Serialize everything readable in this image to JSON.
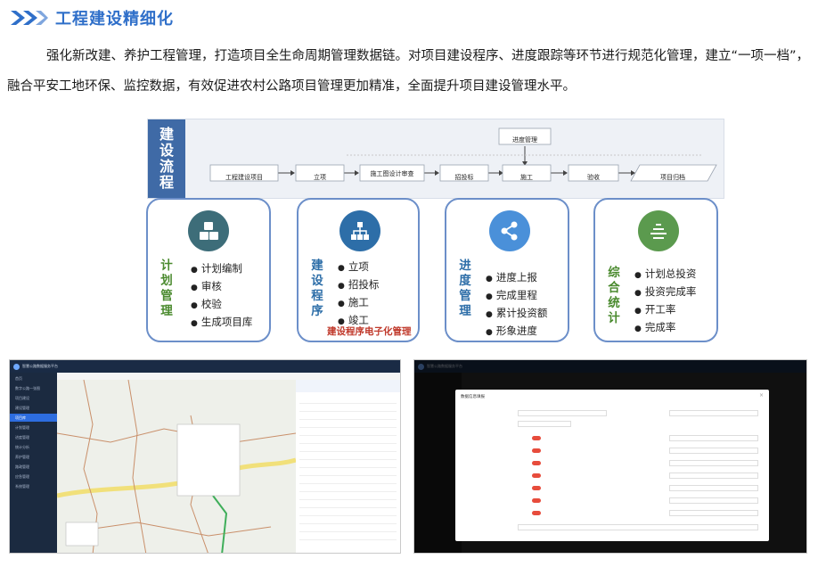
{
  "section": {
    "title": "工程建设精细化",
    "chevron_color": "#2f6fc9"
  },
  "paragraph": {
    "line1": "强化新改建、养护工程管理，打造项目全生命周期管理数据链。对项目建设程序、进度跟踪等环节进行规范化管理，建立“一项一档”，",
    "line2": "融合平安工地环保、监控数据，有效促进农村公路项目管理更加精准，全面提升项目建设管理水平。"
  },
  "flow": {
    "side_label": [
      "建",
      "设",
      "流",
      "程"
    ],
    "steps": [
      "工程建设项目",
      "立项",
      "施工图设计审查",
      "招投标",
      "施工",
      "验收",
      "项目归档"
    ],
    "top_step": "进度管理"
  },
  "cards": [
    {
      "title": [
        "计",
        "划",
        "管",
        "理"
      ],
      "items": [
        "计划编制",
        "审核",
        "校验",
        "生成项目库"
      ],
      "icon": "cubes-icon",
      "color": "#3d6d79"
    },
    {
      "title": [
        "建",
        "设",
        "程",
        "序"
      ],
      "items": [
        "立项",
        "招投标",
        "施工",
        "竣工"
      ],
      "note": "建设程序电子化管理",
      "icon": "org-chart-icon",
      "color": "#2d6ea8"
    },
    {
      "title": [
        "进",
        "度",
        "管",
        "理"
      ],
      "items": [
        "进度上报",
        "完成里程",
        "累计投资额",
        "形象进度"
      ],
      "icon": "share-icon",
      "color": "#4a90d9"
    },
    {
      "title": [
        "综",
        "合",
        "统",
        "计"
      ],
      "items": [
        "计划总投资",
        "投资完成率",
        "开工率",
        "完成率"
      ],
      "icon": "list-icon",
      "color": "#5b9a4e"
    }
  ],
  "title_colors": [
    "#4a8a2e",
    "#2d6ea8",
    "#2d6ea8",
    "#4a8a2e"
  ],
  "screenshot1": {
    "app_title": "智慧公路数据服务平台",
    "sidebar": [
      "首页",
      "数字公路一张图",
      "项目建设",
      "建设管理",
      "项目库",
      "计划管理",
      "进度管理",
      "统计分析",
      "养护管理",
      "路政管理",
      "应急管理",
      "系统管理"
    ],
    "active_index": 4
  },
  "screenshot2": {
    "app_title": "智慧公路数据服务平台",
    "modal_title": "数据信息填报"
  }
}
